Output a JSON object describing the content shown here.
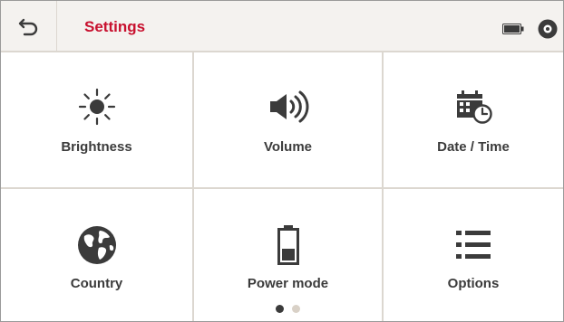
{
  "header": {
    "title": "Settings"
  },
  "tiles": [
    {
      "label": "Brightness",
      "icon": "sun-icon"
    },
    {
      "label": "Volume",
      "icon": "speaker-icon"
    },
    {
      "label": "Date / Time",
      "icon": "calendar-clock-icon"
    },
    {
      "label": "Country",
      "icon": "globe-icon"
    },
    {
      "label": "Power mode",
      "icon": "battery-icon"
    },
    {
      "label": "Options",
      "icon": "list-icon"
    }
  ],
  "pager": {
    "pages": 2,
    "current": 1
  },
  "colors": {
    "accent": "#c8102e",
    "header_bg": "#f4f2ef",
    "divider": "#dcd7d0",
    "icon": "#3b3b3b",
    "dot_active": "#3b3b3b",
    "dot_inactive": "#d9d1c7"
  }
}
